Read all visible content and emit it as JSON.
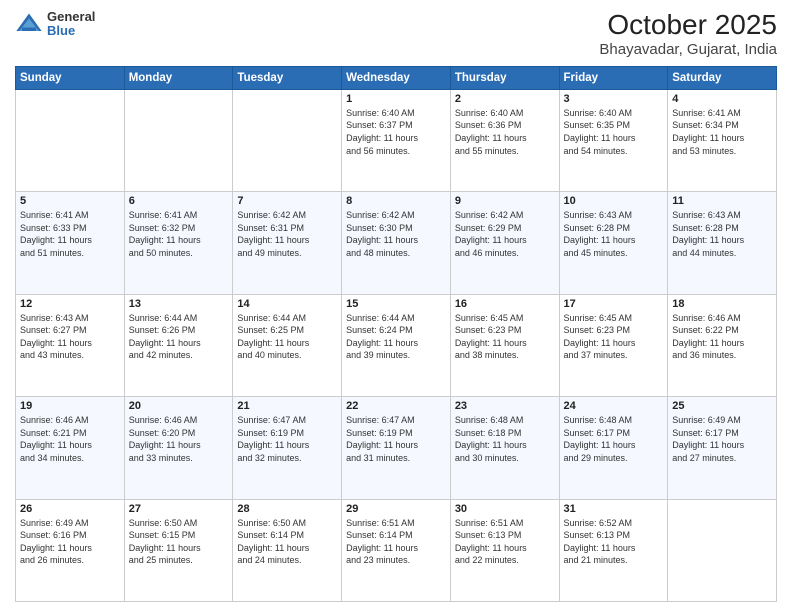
{
  "header": {
    "logo": {
      "general": "General",
      "blue": "Blue"
    },
    "title": "October 2025",
    "subtitle": "Bhayavadar, Gujarat, India"
  },
  "weekdays": [
    "Sunday",
    "Monday",
    "Tuesday",
    "Wednesday",
    "Thursday",
    "Friday",
    "Saturday"
  ],
  "weeks": [
    [
      {
        "day": null,
        "info": null
      },
      {
        "day": null,
        "info": null
      },
      {
        "day": null,
        "info": null
      },
      {
        "day": "1",
        "info": "Sunrise: 6:40 AM\nSunset: 6:37 PM\nDaylight: 11 hours\nand 56 minutes."
      },
      {
        "day": "2",
        "info": "Sunrise: 6:40 AM\nSunset: 6:36 PM\nDaylight: 11 hours\nand 55 minutes."
      },
      {
        "day": "3",
        "info": "Sunrise: 6:40 AM\nSunset: 6:35 PM\nDaylight: 11 hours\nand 54 minutes."
      },
      {
        "day": "4",
        "info": "Sunrise: 6:41 AM\nSunset: 6:34 PM\nDaylight: 11 hours\nand 53 minutes."
      }
    ],
    [
      {
        "day": "5",
        "info": "Sunrise: 6:41 AM\nSunset: 6:33 PM\nDaylight: 11 hours\nand 51 minutes."
      },
      {
        "day": "6",
        "info": "Sunrise: 6:41 AM\nSunset: 6:32 PM\nDaylight: 11 hours\nand 50 minutes."
      },
      {
        "day": "7",
        "info": "Sunrise: 6:42 AM\nSunset: 6:31 PM\nDaylight: 11 hours\nand 49 minutes."
      },
      {
        "day": "8",
        "info": "Sunrise: 6:42 AM\nSunset: 6:30 PM\nDaylight: 11 hours\nand 48 minutes."
      },
      {
        "day": "9",
        "info": "Sunrise: 6:42 AM\nSunset: 6:29 PM\nDaylight: 11 hours\nand 46 minutes."
      },
      {
        "day": "10",
        "info": "Sunrise: 6:43 AM\nSunset: 6:28 PM\nDaylight: 11 hours\nand 45 minutes."
      },
      {
        "day": "11",
        "info": "Sunrise: 6:43 AM\nSunset: 6:28 PM\nDaylight: 11 hours\nand 44 minutes."
      }
    ],
    [
      {
        "day": "12",
        "info": "Sunrise: 6:43 AM\nSunset: 6:27 PM\nDaylight: 11 hours\nand 43 minutes."
      },
      {
        "day": "13",
        "info": "Sunrise: 6:44 AM\nSunset: 6:26 PM\nDaylight: 11 hours\nand 42 minutes."
      },
      {
        "day": "14",
        "info": "Sunrise: 6:44 AM\nSunset: 6:25 PM\nDaylight: 11 hours\nand 40 minutes."
      },
      {
        "day": "15",
        "info": "Sunrise: 6:44 AM\nSunset: 6:24 PM\nDaylight: 11 hours\nand 39 minutes."
      },
      {
        "day": "16",
        "info": "Sunrise: 6:45 AM\nSunset: 6:23 PM\nDaylight: 11 hours\nand 38 minutes."
      },
      {
        "day": "17",
        "info": "Sunrise: 6:45 AM\nSunset: 6:23 PM\nDaylight: 11 hours\nand 37 minutes."
      },
      {
        "day": "18",
        "info": "Sunrise: 6:46 AM\nSunset: 6:22 PM\nDaylight: 11 hours\nand 36 minutes."
      }
    ],
    [
      {
        "day": "19",
        "info": "Sunrise: 6:46 AM\nSunset: 6:21 PM\nDaylight: 11 hours\nand 34 minutes."
      },
      {
        "day": "20",
        "info": "Sunrise: 6:46 AM\nSunset: 6:20 PM\nDaylight: 11 hours\nand 33 minutes."
      },
      {
        "day": "21",
        "info": "Sunrise: 6:47 AM\nSunset: 6:19 PM\nDaylight: 11 hours\nand 32 minutes."
      },
      {
        "day": "22",
        "info": "Sunrise: 6:47 AM\nSunset: 6:19 PM\nDaylight: 11 hours\nand 31 minutes."
      },
      {
        "day": "23",
        "info": "Sunrise: 6:48 AM\nSunset: 6:18 PM\nDaylight: 11 hours\nand 30 minutes."
      },
      {
        "day": "24",
        "info": "Sunrise: 6:48 AM\nSunset: 6:17 PM\nDaylight: 11 hours\nand 29 minutes."
      },
      {
        "day": "25",
        "info": "Sunrise: 6:49 AM\nSunset: 6:17 PM\nDaylight: 11 hours\nand 27 minutes."
      }
    ],
    [
      {
        "day": "26",
        "info": "Sunrise: 6:49 AM\nSunset: 6:16 PM\nDaylight: 11 hours\nand 26 minutes."
      },
      {
        "day": "27",
        "info": "Sunrise: 6:50 AM\nSunset: 6:15 PM\nDaylight: 11 hours\nand 25 minutes."
      },
      {
        "day": "28",
        "info": "Sunrise: 6:50 AM\nSunset: 6:14 PM\nDaylight: 11 hours\nand 24 minutes."
      },
      {
        "day": "29",
        "info": "Sunrise: 6:51 AM\nSunset: 6:14 PM\nDaylight: 11 hours\nand 23 minutes."
      },
      {
        "day": "30",
        "info": "Sunrise: 6:51 AM\nSunset: 6:13 PM\nDaylight: 11 hours\nand 22 minutes."
      },
      {
        "day": "31",
        "info": "Sunrise: 6:52 AM\nSunset: 6:13 PM\nDaylight: 11 hours\nand 21 minutes."
      },
      {
        "day": null,
        "info": null
      }
    ]
  ]
}
